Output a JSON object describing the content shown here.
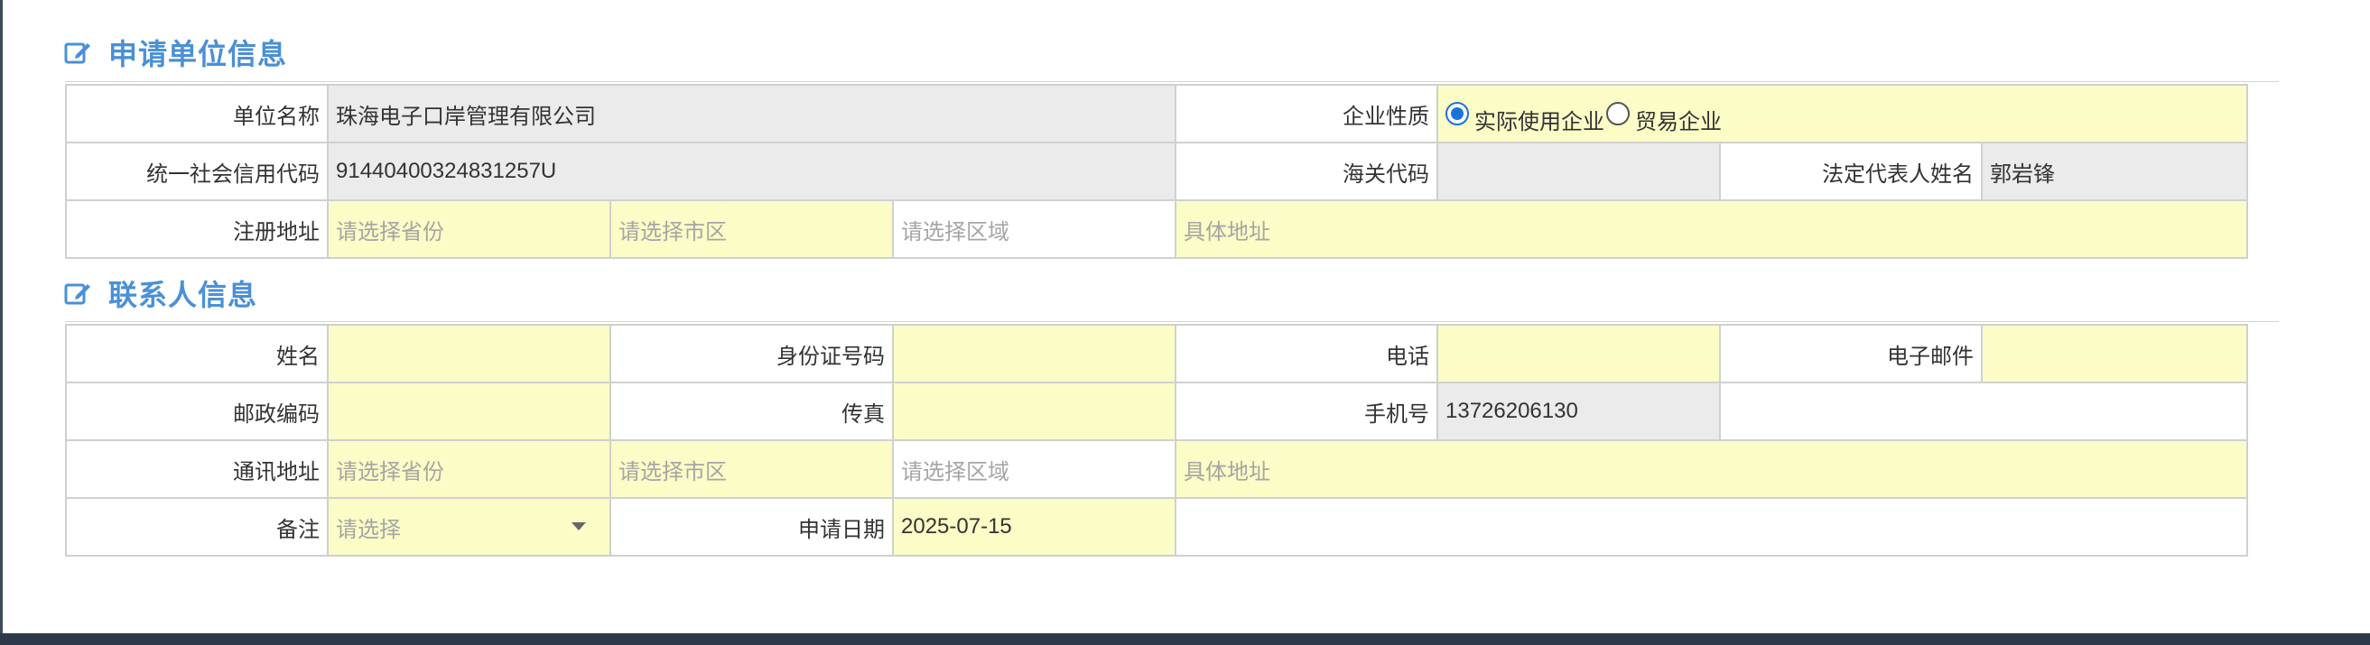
{
  "section_applicant": {
    "title": "申请单位信息",
    "icon": "edit-icon",
    "fields": {
      "unit_name": {
        "label": "单位名称",
        "value": "珠海电子口岸管理有限公司"
      },
      "nature": {
        "label": "企业性质",
        "options": [
          {
            "label": "实际使用企业",
            "checked": true
          },
          {
            "label": "贸易企业",
            "checked": false
          }
        ]
      },
      "credit_code": {
        "label": "统一社会信用代码",
        "value": "91440400324831257U"
      },
      "customs_code": {
        "label": "海关代码",
        "value": ""
      },
      "legal_rep": {
        "label": "法定代表人姓名",
        "value": "郭岩锋"
      },
      "reg_address": {
        "label": "注册地址",
        "province_placeholder": "请选择省份",
        "city_placeholder": "请选择市区",
        "district_placeholder": "请选择区域",
        "detail_placeholder": "具体地址"
      }
    }
  },
  "section_contact": {
    "title": "联系人信息",
    "icon": "edit-icon",
    "fields": {
      "name": {
        "label": "姓名",
        "value": ""
      },
      "id_number": {
        "label": "身份证号码",
        "value": ""
      },
      "phone": {
        "label": "电话",
        "value": ""
      },
      "email": {
        "label": "电子邮件",
        "value": ""
      },
      "postcode": {
        "label": "邮政编码",
        "value": ""
      },
      "fax": {
        "label": "传真",
        "value": ""
      },
      "mobile": {
        "label": "手机号",
        "value": "13726206130"
      },
      "mail_address": {
        "label": "通讯地址",
        "province_placeholder": "请选择省份",
        "city_placeholder": "请选择市区",
        "district_placeholder": "请选择区域",
        "detail_placeholder": "具体地址"
      },
      "remark": {
        "label": "备注",
        "placeholder": "请选择"
      },
      "apply_date": {
        "label": "申请日期",
        "value": "2025-07-15"
      }
    }
  },
  "colors": {
    "section_title": "#4a90d6",
    "required_bg": "#fbfcc6",
    "readonly_bg": "#ebebeb",
    "radio_accent": "#1a73d9"
  }
}
